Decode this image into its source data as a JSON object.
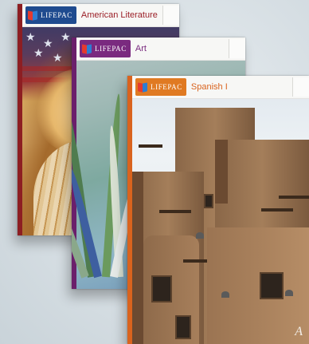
{
  "books": [
    {
      "brand": "LIFEPAC",
      "title": "American Literature"
    },
    {
      "brand": "LIFEPAC",
      "title": "Art"
    },
    {
      "brand": "LIFEPAC",
      "title": "Spanish I"
    }
  ],
  "colors": {
    "american_literature_accent": "#9b1f27",
    "art_accent": "#7a2a7f",
    "spanish_accent": "#d9631e"
  }
}
